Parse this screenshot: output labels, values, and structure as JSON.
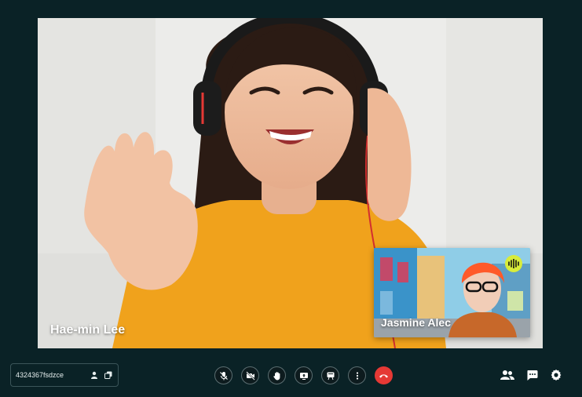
{
  "colors": {
    "background": "#0a2226",
    "control_border": "#5b6e71",
    "end_call": "#e53935",
    "speaking_indicator": "#d8ec3a"
  },
  "main_participant": {
    "name": "Hae-min Lee"
  },
  "pip_participant": {
    "name": "Jasmine Alec",
    "speaking_icon": "audio-wave-icon"
  },
  "meeting": {
    "id": "4324367fsdzce",
    "icons": [
      "person-icon",
      "copy-icon"
    ]
  },
  "controls": [
    {
      "name": "mic-off-button",
      "icon": "mic-off-icon"
    },
    {
      "name": "camera-off-button",
      "icon": "video-off-icon"
    },
    {
      "name": "raise-hand-button",
      "icon": "hand-icon"
    },
    {
      "name": "share-screen-button",
      "icon": "screen-share-icon"
    },
    {
      "name": "present-button",
      "icon": "present-icon"
    },
    {
      "name": "more-options-button",
      "icon": "more-vertical-icon"
    },
    {
      "name": "end-call-button",
      "icon": "phone-hangup-icon"
    }
  ],
  "right_icons": [
    "people-icon",
    "chat-icon",
    "settings-icon"
  ]
}
